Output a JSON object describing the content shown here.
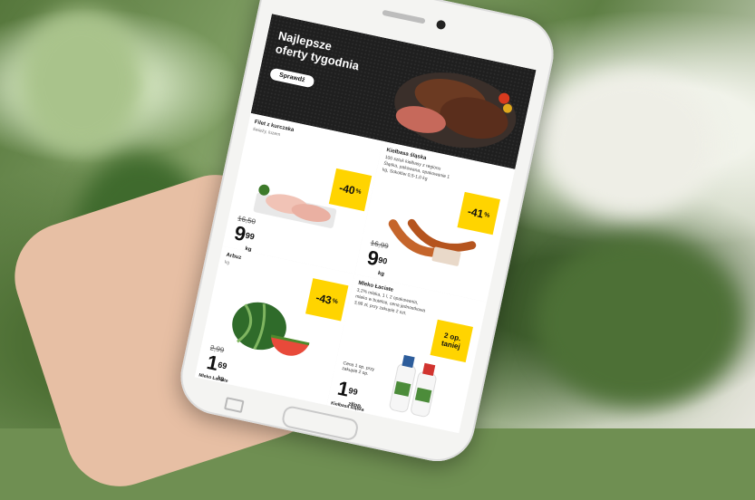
{
  "hero": {
    "title": "Najlepsze\noferty tygodnia",
    "button_label": "Sprawdź"
  },
  "products": [
    {
      "name": "Filet z kurczaka",
      "sub": "świeży, luzem",
      "discount": "-40",
      "old_price": "16,50",
      "price_int": "9",
      "price_cents": "99",
      "unit": "kg"
    },
    {
      "name": "Kiełbasa śląska",
      "desc": "100 sztuk kiełbasy z regionu Śląska, pakowana, opakowanie 1 kg, Sokołów 0,5-1,0 kg",
      "discount": "-41",
      "old_price": "16,99",
      "price_int": "9",
      "price_cents": "90",
      "unit": "kg"
    },
    {
      "name": "Arbuz",
      "sub": "kg",
      "discount": "-43",
      "old_price": "2,99",
      "price_int": "1",
      "price_cents": "69",
      "unit": "kg"
    },
    {
      "name": "Mleko Łaciate",
      "desc": "3,2% mleka, 1 l, 2 opakowania, mleko w butelce, cena jednostkowa 3,98 zł, przy zakupie 2 szt.",
      "discount": "2 op. taniej",
      "note": "Cena 1 op. przy zakupie 2 op.",
      "price_int": "1",
      "price_cents": "99",
      "unit": "zł/op."
    }
  ],
  "bottom_labels": [
    "Mleko Łaciate",
    "Kiełbasa śląska"
  ]
}
